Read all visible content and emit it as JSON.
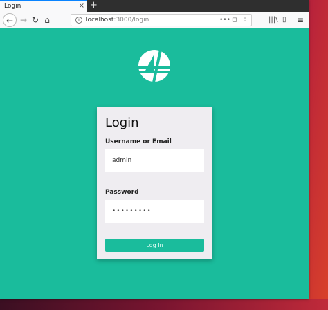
{
  "browser": {
    "tab_title": "Login",
    "tab_close": "×",
    "new_tab": "+",
    "back": "←",
    "forward": "→",
    "reload": "↻",
    "home": "⌂",
    "url_host": "localhost",
    "url_path": ":3000/login",
    "page_actions": "•••",
    "pocket": "◻",
    "bookmark": "☆",
    "library": "|||\\",
    "sidebar": "▯",
    "menu": "≡"
  },
  "login": {
    "title": "Login",
    "username_label": "Username or Email",
    "username_value": "admin",
    "password_label": "Password",
    "password_value": "•••••••••",
    "submit_label": "Log In"
  },
  "colors": {
    "background": "#1abc9c",
    "card": "#efedf1",
    "button": "#1abc9c"
  },
  "icons": {
    "logo": "logo-icon"
  }
}
